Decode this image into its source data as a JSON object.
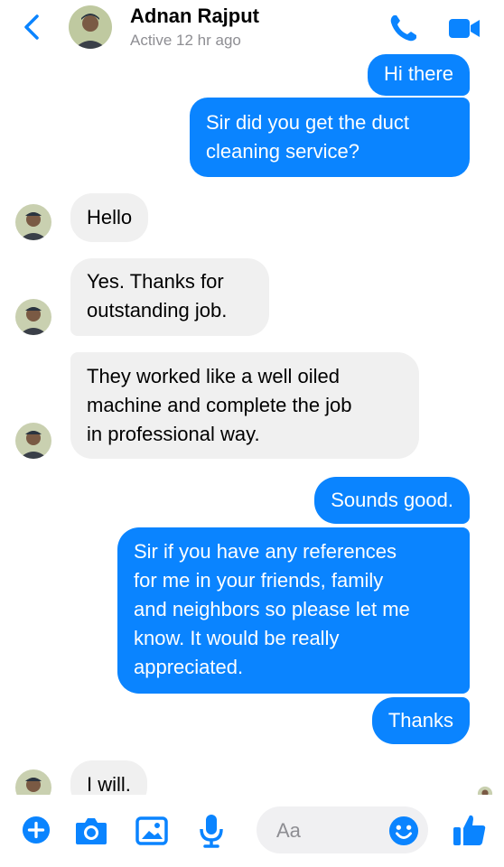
{
  "header": {
    "contact_name": "Adnan Rajput",
    "status": "Active 12 hr ago",
    "icons": [
      "back-chevron-icon",
      "phone-icon",
      "video-camera-icon"
    ]
  },
  "messages": [
    {
      "from": "me",
      "text": "Hi there"
    },
    {
      "from": "me",
      "lines": [
        "Sir did you get the duct",
        "cleaning service?"
      ]
    },
    {
      "from": "them",
      "text": "Hello"
    },
    {
      "from": "them",
      "lines": [
        "Yes. Thanks for",
        "outstanding job."
      ]
    },
    {
      "from": "them",
      "lines": [
        "They worked like a well oiled",
        "machine and complete the job",
        "in professional way."
      ]
    },
    {
      "from": "me",
      "text": "Sounds good."
    },
    {
      "from": "me",
      "lines": [
        "Sir if you have any references",
        "for me in your friends, family",
        "and neighbors so please let me",
        "know. It would be really",
        "appreciated."
      ]
    },
    {
      "from": "me",
      "text": "Thanks"
    },
    {
      "from": "them",
      "text": "I will."
    }
  ],
  "composer": {
    "placeholder": "Aa",
    "icons": [
      "plus-icon",
      "camera-icon",
      "image-icon",
      "microphone-icon",
      "emoji-icon",
      "thumbs-up-icon"
    ]
  },
  "colors": {
    "accent": "#0a84ff",
    "incoming_bubble": "#f0f0f0",
    "muted_text": "#8e8e93"
  }
}
